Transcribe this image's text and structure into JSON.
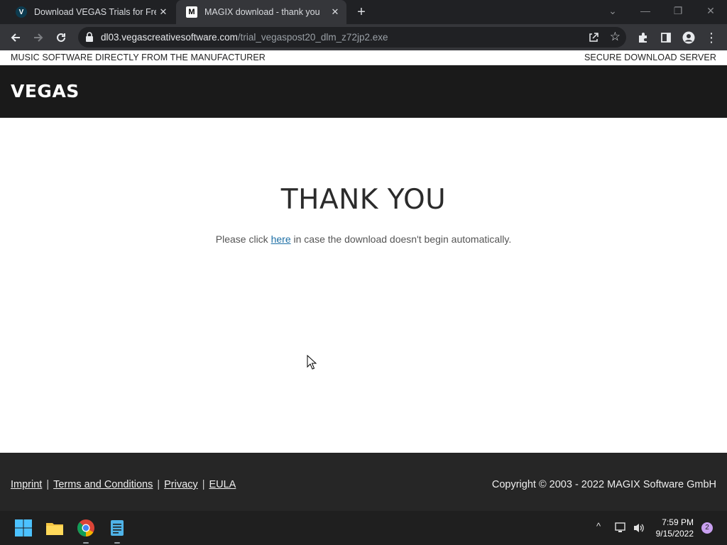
{
  "browser": {
    "tabs": [
      {
        "title": "Download VEGAS Trials for Free |",
        "favicon": "V",
        "favicon_color": "#0d3b4f"
      },
      {
        "title": "MAGIX download - thank you",
        "favicon": "M",
        "favicon_color": "#ffffff"
      }
    ],
    "url_host": "dl03.vegascreativesoftware.com",
    "url_path": "/trial_vegaspost20_dlm_z72jp2.exe"
  },
  "page": {
    "strip_left": "MUSIC SOFTWARE DIRECTLY FROM THE MANUFACTURER",
    "strip_right": "SECURE DOWNLOAD SERVER",
    "logo": "VEGAS",
    "heading": "THANK YOU",
    "message_before": "Please click ",
    "message_link": "here",
    "message_after": " in case the download doesn't begin automatically.",
    "footer_links": [
      "Imprint",
      "Terms and Conditions",
      "Privacy",
      "EULA"
    ],
    "copyright": "Copyright © 2003 - 2022 MAGIX Software GmbH"
  },
  "taskbar": {
    "time": "7:59 PM",
    "date": "9/15/2022",
    "notifications": "2"
  },
  "colors": {
    "header_bg": "#1a1a1a",
    "footer_bg": "#262626",
    "link": "#1d6fa5"
  }
}
